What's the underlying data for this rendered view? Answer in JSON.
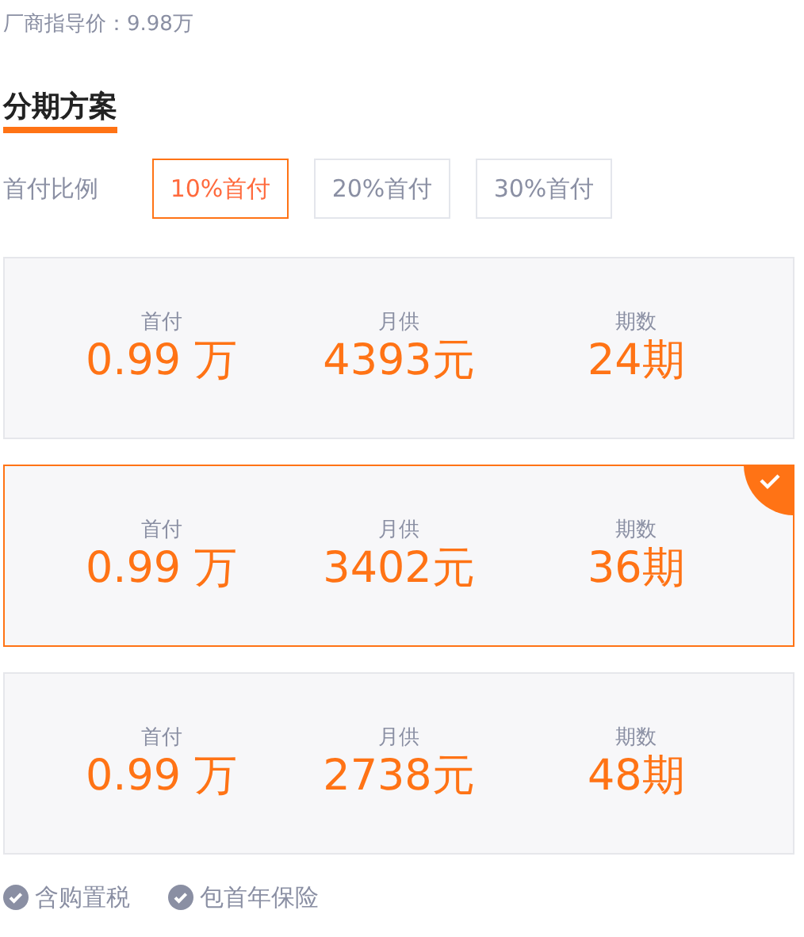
{
  "guide_price": "厂商指导价：9.98万",
  "section_title": "分期方案",
  "ratio": {
    "label": "首付比例",
    "options": [
      {
        "label": "10%首付",
        "selected": true
      },
      {
        "label": "20%首付",
        "selected": false
      },
      {
        "label": "30%首付",
        "selected": false
      }
    ]
  },
  "plans": [
    {
      "selected": false,
      "fields": [
        {
          "label": "首付",
          "value": "0.99 万"
        },
        {
          "label": "月供",
          "value": "4393元"
        },
        {
          "label": "期数",
          "value": "24期"
        }
      ]
    },
    {
      "selected": true,
      "fields": [
        {
          "label": "首付",
          "value": "0.99 万"
        },
        {
          "label": "月供",
          "value": "3402元"
        },
        {
          "label": "期数",
          "value": "36期"
        }
      ]
    },
    {
      "selected": false,
      "fields": [
        {
          "label": "首付",
          "value": "0.99 万"
        },
        {
          "label": "月供",
          "value": "2738元"
        },
        {
          "label": "期数",
          "value": "48期"
        }
      ]
    }
  ],
  "features": [
    "含购置税",
    "包首年保险"
  ]
}
